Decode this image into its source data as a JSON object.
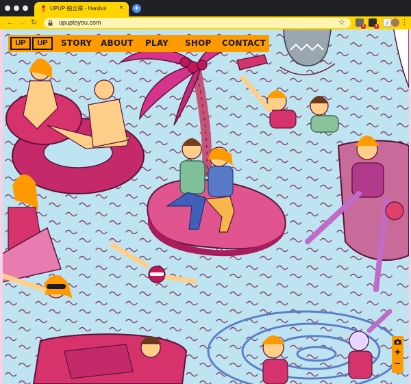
{
  "browser": {
    "tab_title": "UPUP 拍立得 - Haniboi",
    "tab_close": "×",
    "new_tab": "+",
    "back": "←",
    "forward": "→",
    "reload": "↻",
    "url": "upuptoyou.com",
    "bookmark": "☆",
    "extension_badge_1": "1",
    "extension_badge_2": "1",
    "menu": "⋮",
    "colors": {
      "tab": "#ffd400",
      "toolbar": "#ffd400",
      "titlebar": "#202124"
    }
  },
  "site": {
    "logo": [
      "UP",
      "UP"
    ],
    "nav": [
      "STORY",
      "ABOUT",
      "PLAY",
      "SHOP",
      "CONTACT"
    ],
    "nav_color": "#ff9a00",
    "controls": {
      "camera": "camera",
      "zoom_in": "+",
      "zoom_out": "−"
    }
  },
  "scene": {
    "description_colors": {
      "water": "#bfe4f1",
      "wave": "#7a1f4a",
      "magenta": "#d6336c",
      "skin": "#ffcf8a"
    }
  }
}
